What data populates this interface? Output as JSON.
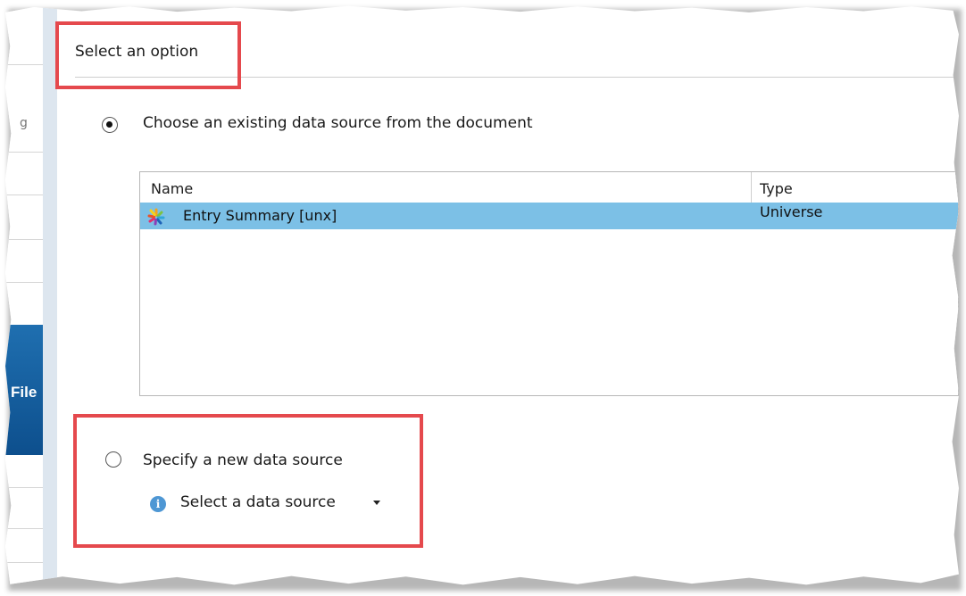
{
  "left_strip": {
    "fragment": "g",
    "file_label": "File"
  },
  "dialog": {
    "header": "Select an option",
    "option_existing": {
      "label": "Choose an existing data source from the document",
      "checked": true
    },
    "table": {
      "columns": [
        "Name",
        "Type"
      ],
      "rows": [
        {
          "name": "Entry Summary [unx]",
          "type": "Universe",
          "icon": "universe-icon",
          "selected": true
        }
      ],
      "selected_color": "#7cc0e6"
    },
    "option_new": {
      "label": "Specify a new data source",
      "checked": false
    },
    "select_source": {
      "label": "Select a data source",
      "icon": "info-icon"
    }
  },
  "highlight_color": "#e5494d"
}
